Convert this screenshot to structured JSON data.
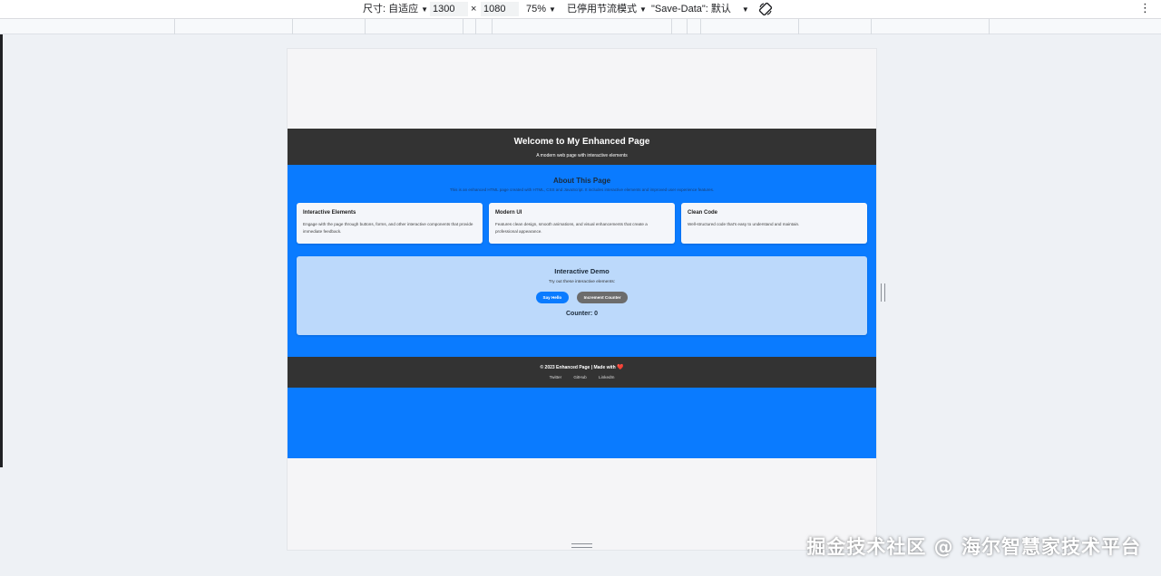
{
  "devtools": {
    "dimensions_label": "尺寸: 自适应",
    "width": "1300",
    "times": "×",
    "height": "1080",
    "zoom": "75%",
    "throttle": "已停用节流模式",
    "save_data": "\"Save-Data\": 默认"
  },
  "page": {
    "header": {
      "title": "Welcome to My Enhanced Page",
      "subtitle": "A modern web page with interactive elements"
    },
    "about": {
      "title": "About This Page",
      "subtitle": "This is an enhanced HTML page created with HTML, CSS and JavaScript. It includes interactive elements and improved user experience features."
    },
    "features": [
      {
        "title": "Interactive Elements",
        "text": "Engage with the page through buttons, forms, and other interactive components that provide immediate feedback."
      },
      {
        "title": "Modern UI",
        "text": "Features clean design, smooth animations, and visual enhancements that create a professional appearance."
      },
      {
        "title": "Clean Code",
        "text": "Well-structured code that's easy to understand and maintain."
      }
    ],
    "demo": {
      "title": "Interactive Demo",
      "subtitle": "Try out these interactive elements:",
      "say_hello": "Say Hello",
      "increment": "Increment Counter",
      "counter": "Counter: 0"
    },
    "footer": {
      "copyright": "© 2023 Enhanced Page | Made with",
      "heart": "❤️",
      "links": [
        "Twitter",
        "GitHub",
        "LinkedIn"
      ]
    }
  },
  "watermark": "掘金技术社区 @ 海尔智慧家技术平台",
  "colors": {
    "header_bg": "#333333",
    "primary": "#0a7bff",
    "demo_bg": "#bcd9fb",
    "secondary_button": "#6c6c6c"
  }
}
